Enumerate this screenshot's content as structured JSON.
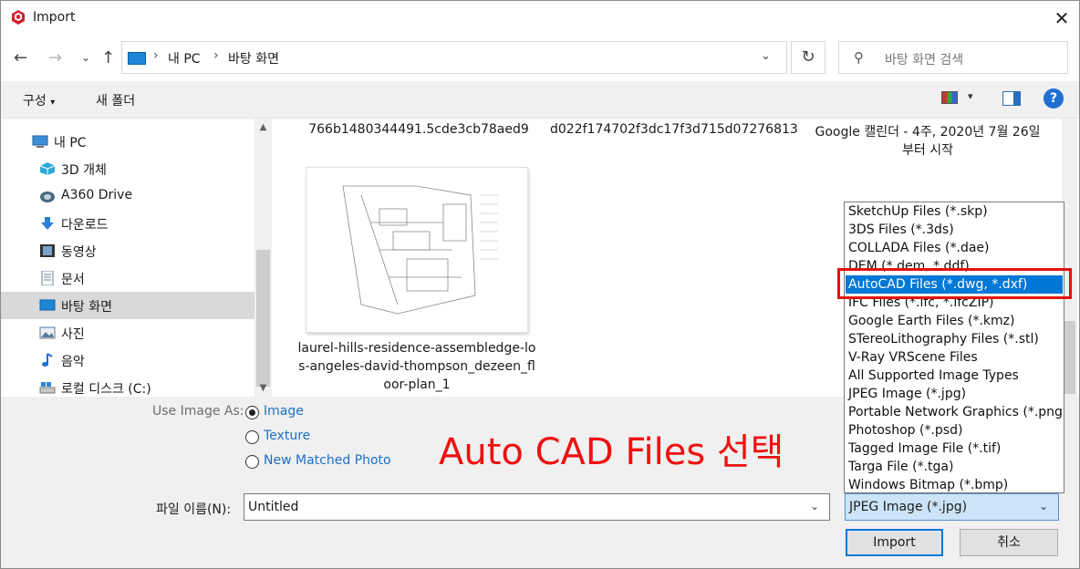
{
  "window": {
    "title": "Import"
  },
  "nav": {
    "path": [
      "내 PC",
      "바탕 화면"
    ],
    "search_placeholder": "바탕 화면 검색"
  },
  "toolbar": {
    "organize": "구성",
    "new_folder": "새 폴더"
  },
  "sidebar": {
    "items": [
      {
        "label": "내 PC",
        "icon": "pc-icon"
      },
      {
        "label": "3D 개체",
        "icon": "3d-objects-icon"
      },
      {
        "label": "A360 Drive",
        "icon": "a360-drive-icon"
      },
      {
        "label": "다운로드",
        "icon": "download-icon"
      },
      {
        "label": "동영상",
        "icon": "video-icon"
      },
      {
        "label": "문서",
        "icon": "document-icon"
      },
      {
        "label": "바탕 화면",
        "icon": "desktop-icon"
      },
      {
        "label": "사진",
        "icon": "picture-icon"
      },
      {
        "label": "음악",
        "icon": "music-icon"
      },
      {
        "label": "로컬 디스크 (C:)",
        "icon": "disk-icon"
      }
    ]
  },
  "files": {
    "top_row": [
      "766b1480344491.5cde3cb78aed9",
      "d022f174702f3dc17f3d715d07276813",
      "Google 캘린더 - 4주, 2020년 7월 26일",
      "부터 시작"
    ],
    "thumb_file_lines": [
      "laurel-hills-residence-assembledge-lo",
      "s-angeles-david-thompson_dezeen_fl",
      "oor-plan_1"
    ]
  },
  "options": {
    "label": "Use Image As:",
    "radios": [
      "Image",
      "Texture",
      "New Matched Photo"
    ],
    "selected": "Image"
  },
  "annotation": "Auto CAD Files 선택",
  "filename": {
    "label": "파일 이름(N):",
    "value": "Untitled"
  },
  "filetype": {
    "value": "JPEG Image (*.jpg)",
    "options": [
      "SketchUp Files (*.skp)",
      "3DS Files (*.3ds)",
      "COLLADA Files (*.dae)",
      "DEM (*.dem, *.ddf)",
      "AutoCAD Files (*.dwg, *.dxf)",
      "IFC Files (*.ifc, *.ifcZIP)",
      "Google Earth Files (*.kmz)",
      "STereoLithography Files (*.stl)",
      "V-Ray VRScene Files",
      "All Supported Image Types",
      "JPEG Image (*.jpg)",
      "Portable Network Graphics (*.png)",
      "Photoshop (*.psd)",
      "Tagged Image File (*.tif)",
      "Targa File (*.tga)",
      "Windows Bitmap (*.bmp)"
    ],
    "highlighted": "AutoCAD Files (*.dwg, *.dxf)"
  },
  "buttons": {
    "import": "Import",
    "cancel": "취소"
  },
  "colors": {
    "accent": "#0078d7",
    "annotation": "#ee1111",
    "link": "#1f6fc5"
  }
}
